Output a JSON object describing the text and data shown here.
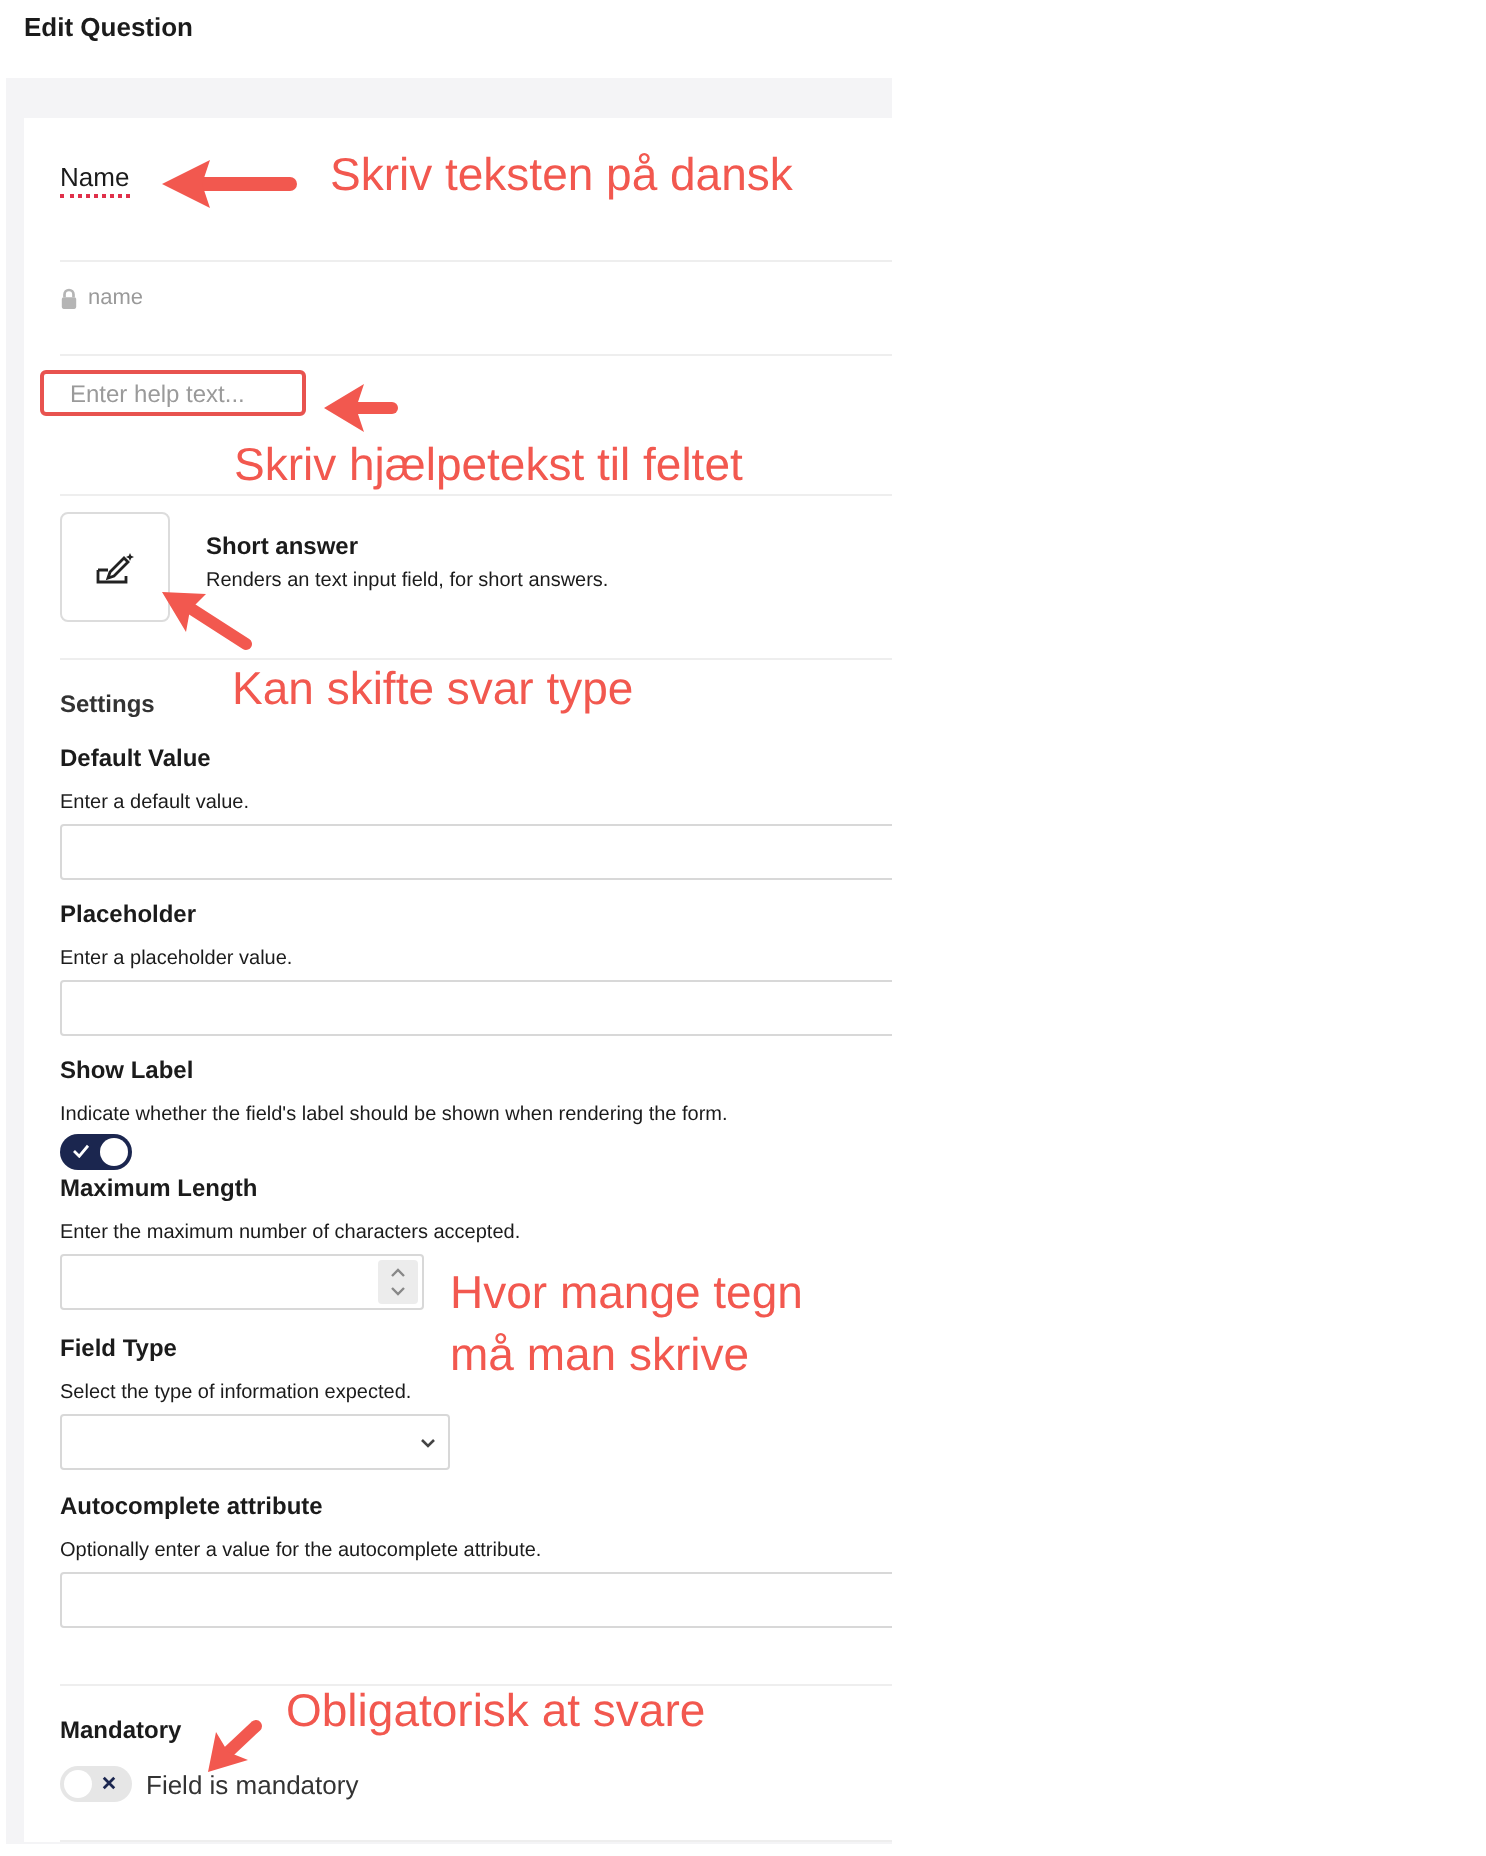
{
  "title": "Edit Question",
  "name_field": {
    "label": "Name",
    "note": "Skriv teksten på dansk"
  },
  "alias": {
    "text": "name"
  },
  "help_field": {
    "placeholder": "Enter help text...",
    "note": "Skriv hjælpetekst til feltet"
  },
  "editor": {
    "title": "Short answer",
    "description": "Renders an text input field, for short answers.",
    "note": "Kan skifte svar type"
  },
  "settings_heading": "Settings",
  "settings": [
    {
      "kind": "text",
      "label": "Default Value",
      "description": "Enter a default value."
    },
    {
      "kind": "text",
      "label": "Placeholder",
      "description": "Enter a placeholder value."
    },
    {
      "kind": "toggle",
      "label": "Show Label",
      "description": "Indicate whether the field's label should be shown when rendering the form.",
      "on": true
    },
    {
      "kind": "number",
      "label": "Maximum Length",
      "description": "Enter the maximum number of characters accepted.",
      "note": "Hvor mange tegn må man skrive"
    },
    {
      "kind": "select",
      "label": "Field Type",
      "description": "Select the type of information expected."
    },
    {
      "kind": "text",
      "label": "Autocomplete attribute",
      "description": "Optionally enter a value for the autocomplete attribute."
    }
  ],
  "mandatory": {
    "label": "Mandatory",
    "toggle_label": "Field is mandatory",
    "on": false,
    "note": "Obligatorisk at svare"
  }
}
